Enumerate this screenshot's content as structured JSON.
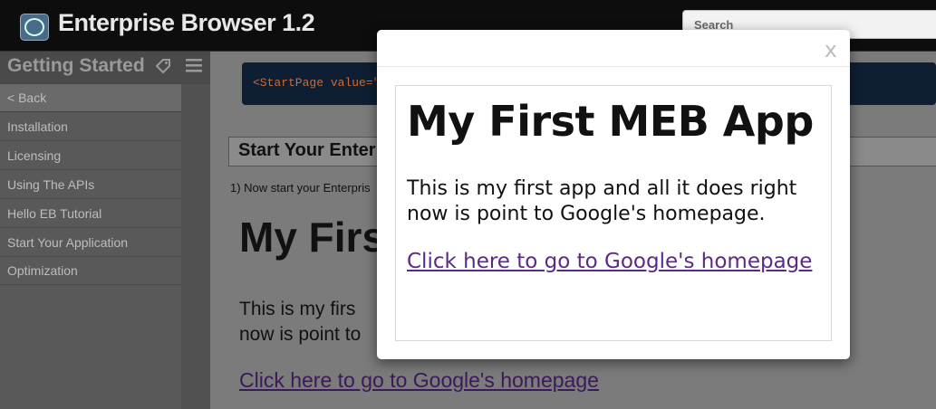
{
  "header": {
    "app_title": "Enterprise Browser 1.2",
    "logo_icon": "enterprise-browser-logo-icon",
    "search_placeholder": "Search"
  },
  "sidebar": {
    "title": "Getting Started",
    "tag_icon": "tag-icon",
    "menu_icon": "hamburger-menu-icon",
    "back_label": "< Back",
    "items": [
      {
        "label": "Installation"
      },
      {
        "label": "Licensing"
      },
      {
        "label": "Using The APIs"
      },
      {
        "label": "Hello EB Tutorial"
      },
      {
        "label": "Start Your Application"
      },
      {
        "label": "Optimization"
      }
    ]
  },
  "main": {
    "code_text": "<StartPage value=\"f",
    "section_title": "Start Your Enter",
    "step_text": "1) Now start your Enterpris",
    "bg_heading": "My Firs",
    "bg_paragraph_line1": "This is my firs",
    "bg_paragraph_line2": "now is point to",
    "bg_link": "Click here to go to Google's homepage"
  },
  "modal": {
    "close_label": "x",
    "heading": "My First MEB App",
    "paragraph": "This is my first app and all it does right now is point to Google's homepage.",
    "link": "Click here to go to Google's homepage"
  },
  "colors": {
    "header_bg": "#0d0d0d",
    "sidebar_bg": "#595959",
    "link_color": "#5b2a86",
    "code_bg": "#0e1f33"
  }
}
